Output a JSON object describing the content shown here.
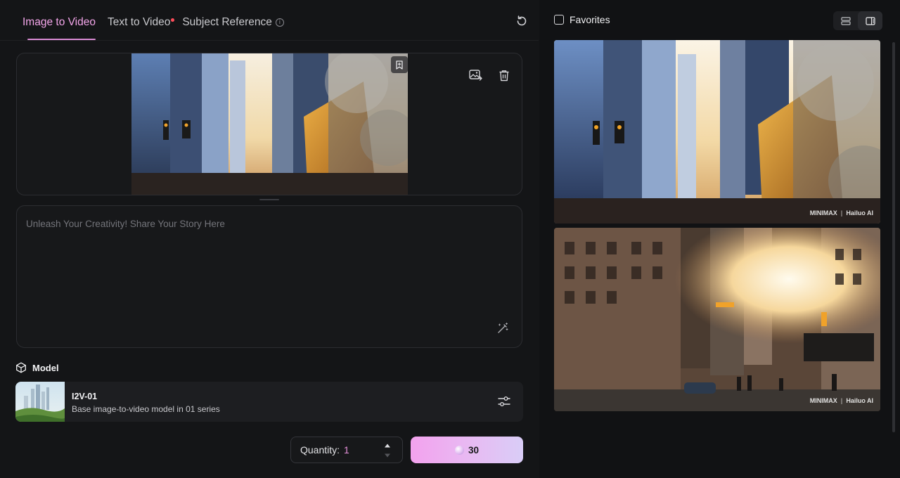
{
  "tabs": [
    {
      "label": "Image to Video"
    },
    {
      "label": "Text to Video"
    },
    {
      "label": "Subject Reference"
    }
  ],
  "prompt": {
    "placeholder": "Unleash Your Creativity! Share Your Story Here"
  },
  "model": {
    "section_label": "Model",
    "name": "I2V-01",
    "description": "Base image-to-video model in 01 series"
  },
  "quantity": {
    "label": "Quantity:",
    "value": "1"
  },
  "generate": {
    "cost": "30"
  },
  "favorites": {
    "label": "Favorites"
  },
  "videos": [
    {
      "watermark_left": "MINIMAX",
      "watermark_right": "Hailuo AI"
    },
    {
      "watermark_left": "MINIMAX",
      "watermark_right": "Hailuo AI"
    }
  ],
  "icons": {
    "refresh": "refresh-icon",
    "bookmark": "bookmark-icon",
    "replace_image": "replace-image-icon",
    "delete": "trash-icon",
    "magic": "magic-wand-icon",
    "model": "cube-icon",
    "settings": "sliders-icon"
  },
  "colors": {
    "accent": "#f4a6ea",
    "background": "#141517",
    "generate_gradient_start": "#f3a2ee",
    "generate_gradient_end": "#d9cdf7"
  }
}
